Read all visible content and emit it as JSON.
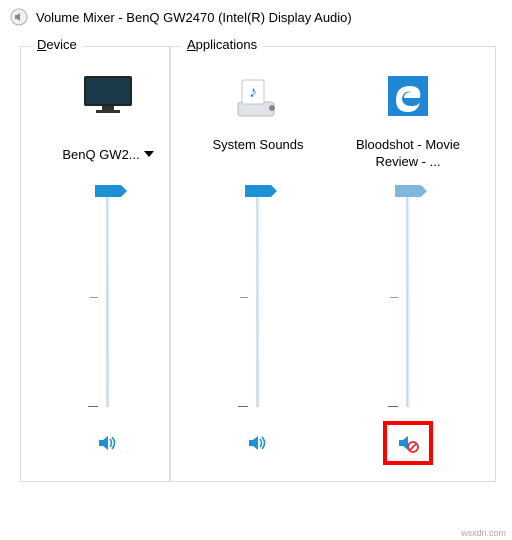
{
  "window": {
    "title": "Volume Mixer - BenQ GW2470 (Intel(R) Display Audio)"
  },
  "device_section": {
    "label": "Device",
    "device_name": "BenQ GW2...",
    "volume_percent": 98,
    "muted": false
  },
  "apps_section": {
    "label": "Applications",
    "apps": [
      {
        "name": "System Sounds",
        "volume_percent": 98,
        "muted": false,
        "icon": "system-sounds"
      },
      {
        "name": "Bloodshot - Movie Review - ...",
        "volume_percent": 98,
        "muted": true,
        "icon": "edge"
      }
    ]
  },
  "watermark": "wsxdn.com"
}
